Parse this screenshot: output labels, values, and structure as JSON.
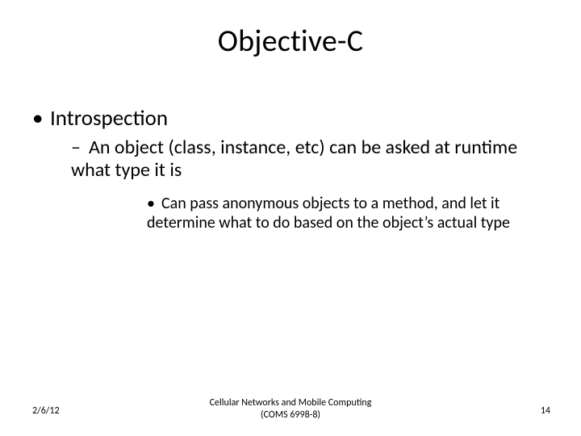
{
  "title": "Objective-C",
  "bullets": {
    "lvl1": "Introspection",
    "lvl2": "An object (class, instance, etc) can be asked at runtime what type it is",
    "lvl3": "Can pass anonymous objects to a method, and let it determine what to do based on the object’s actual type"
  },
  "footer": {
    "date": "2/6/12",
    "center_line1": "Cellular Networks and Mobile Computing",
    "center_line2": "(COMS 6998-8)",
    "page": "14"
  }
}
